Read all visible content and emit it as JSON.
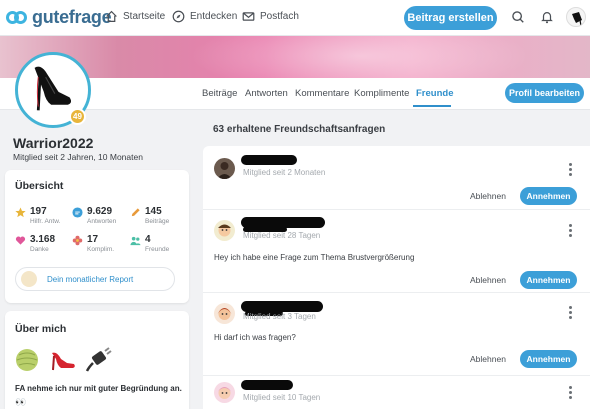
{
  "brand": {
    "name": "gutefrage"
  },
  "topnav": {
    "links": [
      {
        "label": "Startseite",
        "icon": "home-icon"
      },
      {
        "label": "Entdecken",
        "icon": "compass-icon"
      },
      {
        "label": "Postfach",
        "icon": "mail-icon"
      }
    ],
    "create_label": "Beitrag erstellen",
    "icons": [
      "search-icon",
      "bell-icon",
      "user-avatar"
    ]
  },
  "profile": {
    "username": "Warrior2022",
    "member_since": "Mitglied seit 2 Jahren, 10 Monaten",
    "level": "49",
    "edit_label": "Profil bearbeiten"
  },
  "tabs": [
    {
      "label": "Beiträge",
      "active": false
    },
    {
      "label": "Antworten",
      "active": false
    },
    {
      "label": "Kommentare",
      "active": false
    },
    {
      "label": "Komplimente",
      "active": false
    },
    {
      "label": "Freunde",
      "active": true
    }
  ],
  "overview": {
    "title": "Übersicht",
    "stats": [
      {
        "value": "197",
        "label": "Hilfr. Antw.",
        "icon": "star-icon",
        "color": "#e8b53a"
      },
      {
        "value": "9.629",
        "label": "Antworten",
        "icon": "speech-bubble-icon",
        "color": "#3c9fd8"
      },
      {
        "value": "145",
        "label": "Beiträge",
        "icon": "pencil-icon",
        "color": "#e89a3a"
      },
      {
        "value": "3.168",
        "label": "Danke",
        "icon": "heart-icon",
        "color": "#e0579a"
      },
      {
        "value": "17",
        "label": "Komplim.",
        "icon": "flower-icon",
        "color": "#e06a6a"
      },
      {
        "value": "4",
        "label": "Freunde",
        "icon": "friends-icon",
        "color": "#4cbfa6"
      }
    ],
    "report_label": "Dein monatlicher Report"
  },
  "about": {
    "title": "Über mich",
    "emojis": [
      "melon-icon",
      "high-heel-icon",
      "plug-icon"
    ],
    "text": "FA nehme ich nur mit guter Begründung an.",
    "emoji_after": "👀"
  },
  "requests": {
    "heading": "63 erhaltene Freundschaftsanfragen",
    "decline_label": "Ablehnen",
    "accept_label": "Annehmen",
    "items": [
      {
        "meta": "Mitglied seit 2 Monaten",
        "message": ""
      },
      {
        "meta": "Mitglied seit 28 Tagen",
        "message": "Hey ich habe eine Frage zum Thema Brustvergrößerung"
      },
      {
        "meta": "Mitglied seit 3 Tagen",
        "message": "Hi darf ich was fragen?"
      },
      {
        "meta": "Mitglied seit 10 Tagen",
        "message": ""
      }
    ]
  },
  "colors": {
    "accent": "#3c9fd8",
    "brand": "#3a6d92",
    "badge": "#e8b53a"
  }
}
